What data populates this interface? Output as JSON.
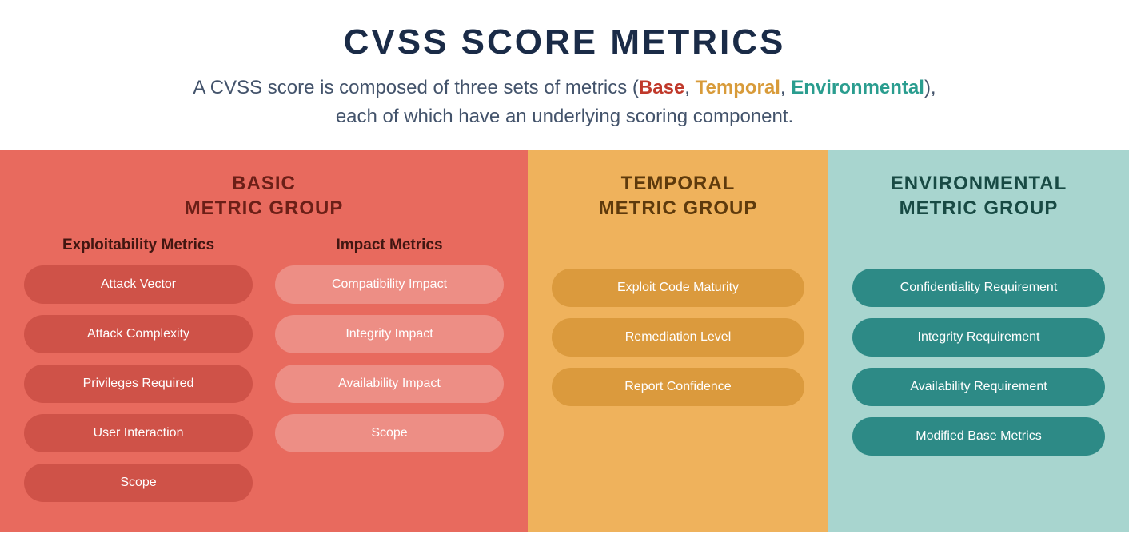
{
  "header": {
    "title": "CVSS SCORE METRICS",
    "subtitle_pre": "A CVSS score is composed of three sets of metrics (",
    "sub_base": "Base",
    "sep1": ", ",
    "sub_temporal": "Temporal",
    "sep2": ", ",
    "sub_env": "Environmental",
    "subtitle_post_line1": "),",
    "subtitle_line2": "each of which have an underlying scoring component."
  },
  "groups": {
    "basic": {
      "title_line1": "BASIC",
      "title_line2": "METRIC GROUP",
      "exploit_heading": "Exploitability Metrics",
      "impact_heading": "Impact Metrics",
      "exploit_items": [
        "Attack Vector",
        "Attack Complexity",
        "Privileges Required",
        "User Interaction",
        "Scope"
      ],
      "impact_items": [
        "Compatibility Impact",
        "Integrity Impact",
        "Availability Impact",
        "Scope"
      ]
    },
    "temporal": {
      "title_line1": "TEMPORAL",
      "title_line2": "METRIC GROUP",
      "items": [
        "Exploit Code Maturity",
        "Remediation Level",
        "Report Confidence"
      ]
    },
    "environmental": {
      "title_line1": "ENVIRONMENTAL",
      "title_line2": "METRIC GROUP",
      "items": [
        "Confidentiality Requirement",
        "Integrity Requirement",
        "Availability Requirement",
        "Modified Base Metrics"
      ]
    }
  }
}
